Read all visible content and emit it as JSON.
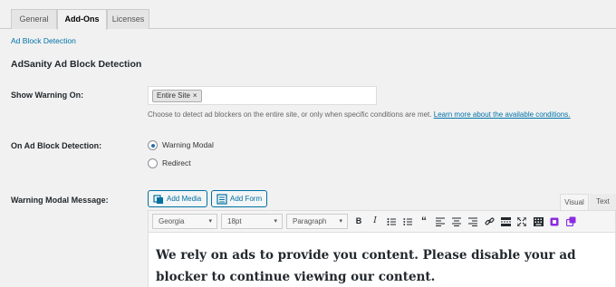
{
  "tabs": [
    {
      "label": "General",
      "active": false
    },
    {
      "label": "Add-Ons",
      "active": true
    },
    {
      "label": "Licenses",
      "active": false
    }
  ],
  "subnav": {
    "link": "Ad Block Detection"
  },
  "section": {
    "title": "AdSanity Ad Block Detection"
  },
  "show_warning": {
    "label": "Show Warning On:",
    "token": "Entire Site",
    "token_remove": "×",
    "description": "Choose to detect ad blockers on the entire site, or only when specific conditions are met.",
    "link": "Learn more about the available conditions."
  },
  "on_detection": {
    "label": "On Ad Block Detection:",
    "options": [
      {
        "label": "Warning Modal",
        "checked": true
      },
      {
        "label": "Redirect",
        "checked": false
      }
    ]
  },
  "message": {
    "label": "Warning Modal Message:",
    "add_media": "Add Media",
    "add_form": "Add Form",
    "tab_visual": "Visual",
    "tab_text": "Text",
    "font_family": "Georgia",
    "font_size": "18pt",
    "format": "Paragraph",
    "content": "We rely on ads to provide you content. Please disable your ad blocker to continue viewing our content."
  },
  "icons": {
    "caret": "▾"
  },
  "colors": {
    "accent": "#0073aa",
    "background": "#f1f1f1",
    "toolbar_purple": "#8a2be2"
  }
}
